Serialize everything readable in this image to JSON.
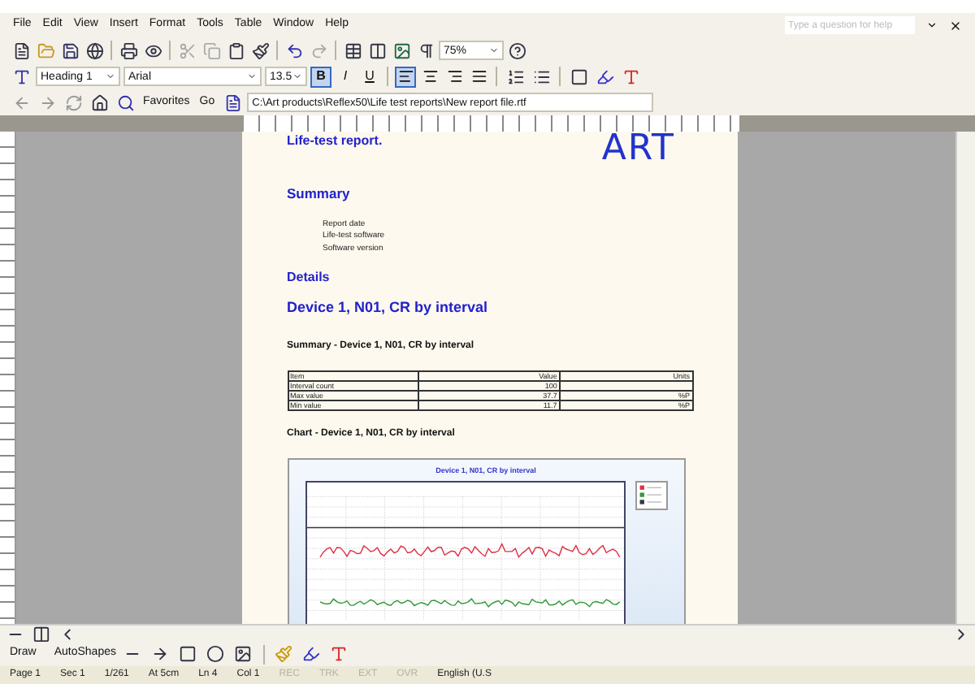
{
  "menu": [
    "File",
    "Edit",
    "View",
    "Insert",
    "Format",
    "Tools",
    "Table",
    "Window",
    "Help"
  ],
  "help_search": {
    "placeholder": "Type a question for help"
  },
  "standard_toolbar": {
    "zoom": "75%"
  },
  "formatting_toolbar": {
    "style": "Heading 1",
    "font": "Arial",
    "size": "13.5",
    "text_buttons": [
      {
        "label": "B",
        "selected": true
      },
      {
        "label": "I",
        "selected": false
      },
      {
        "label": "U",
        "selected": false
      }
    ],
    "alignment": [
      {
        "kind": "left",
        "selected": true
      },
      {
        "kind": "center",
        "selected": false
      },
      {
        "kind": "right",
        "selected": false
      },
      {
        "kind": "justify",
        "selected": false
      }
    ]
  },
  "web_toolbar": {
    "favorites": "Favorites",
    "go": "Go",
    "address": "C:\\Art products\\Reflex50\\Life test reports\\New report file.rtf"
  },
  "document": {
    "title": "Life-test report.",
    "logo": "ART",
    "summary_heading": "Summary",
    "summary_lines": [
      "Report date",
      "Life-test software",
      "Software version"
    ],
    "details_heading": "Details",
    "device_heading": "Device 1, N01, CR by interval",
    "table_caption": "Summary - Device 1, N01, CR by interval",
    "table_rows": [
      [
        "Item",
        "Value",
        "Units"
      ],
      [
        "Interval count",
        "100"
      ],
      [
        "Max value",
        "37.7",
        "%P"
      ],
      [
        "Min value",
        "11.7",
        "%P"
      ]
    ],
    "chart_caption": "Chart - Device 1, N01, CR by interval",
    "chart_title": "Device 1, N01, CR by interval"
  },
  "drawing_toolbar": {
    "draw": "Draw",
    "autoshapes": "AutoShapes"
  },
  "status_bar": [
    {
      "text": "Page 1",
      "disabled": false
    },
    {
      "text": "Sec 1",
      "disabled": false
    },
    {
      "text": "1/261",
      "disabled": false
    },
    {
      "text": "At 5cm",
      "disabled": false
    },
    {
      "text": "Ln 4",
      "disabled": false
    },
    {
      "text": "Col 1",
      "disabled": false
    },
    {
      "text": "REC",
      "disabled": true
    },
    {
      "text": "TRK",
      "disabled": true
    },
    {
      "text": "EXT",
      "disabled": true
    },
    {
      "text": "OVR",
      "disabled": true
    },
    {
      "text": "English (U.S",
      "disabled": false
    }
  ]
}
